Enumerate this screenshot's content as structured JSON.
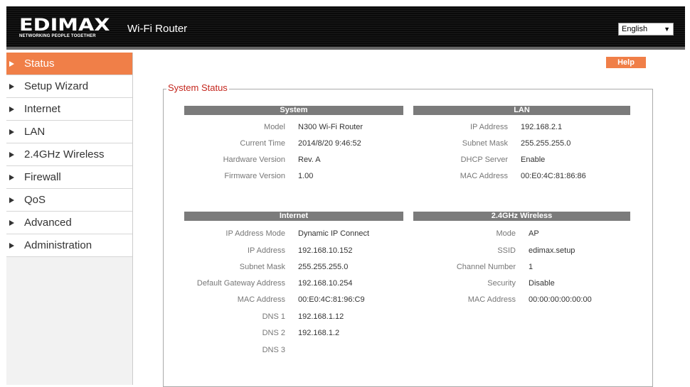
{
  "header": {
    "logo_text": "EDIMAX",
    "logo_tagline": "NETWORKING PEOPLE TOGETHER",
    "product_name": "Wi-Fi Router",
    "language": "English"
  },
  "sidebar": {
    "items": [
      {
        "label": "Status",
        "active": true
      },
      {
        "label": "Setup Wizard"
      },
      {
        "label": "Internet"
      },
      {
        "label": "LAN"
      },
      {
        "label": "2.4GHz Wireless"
      },
      {
        "label": "Firewall"
      },
      {
        "label": "QoS"
      },
      {
        "label": "Advanced"
      },
      {
        "label": "Administration"
      }
    ]
  },
  "help_label": "Help",
  "status": {
    "title": "System Status",
    "system": {
      "header": "System",
      "rows": [
        {
          "label": "Model",
          "value": "N300 Wi-Fi Router"
        },
        {
          "label": "Current Time",
          "value": "2014/8/20 9:46:52"
        },
        {
          "label": "Hardware Version",
          "value": "Rev. A"
        },
        {
          "label": "Firmware Version",
          "value": "1.00"
        }
      ]
    },
    "lan": {
      "header": "LAN",
      "rows": [
        {
          "label": "IP Address",
          "value": "192.168.2.1"
        },
        {
          "label": "Subnet Mask",
          "value": "255.255.255.0"
        },
        {
          "label": "DHCP Server",
          "value": "Enable"
        },
        {
          "label": "MAC Address",
          "value": "00:E0:4C:81:86:86"
        }
      ]
    },
    "internet": {
      "header": "Internet",
      "rows": [
        {
          "label": "IP Address Mode",
          "value": "Dynamic IP  Connect"
        },
        {
          "label": "IP Address",
          "value": "192.168.10.152"
        },
        {
          "label": "Subnet Mask",
          "value": "255.255.255.0"
        },
        {
          "label": "Default Gateway Address",
          "value": "192.168.10.254"
        },
        {
          "label": "MAC Address",
          "value": "00:E0:4C:81:96:C9"
        },
        {
          "label": "DNS 1",
          "value": "192.168.1.12"
        },
        {
          "label": "DNS 2",
          "value": "192.168.1.2"
        },
        {
          "label": "DNS 3",
          "value": ""
        }
      ]
    },
    "wireless": {
      "header": "2.4GHz  Wireless",
      "rows": [
        {
          "label": "Mode",
          "value": "AP"
        },
        {
          "label": "SSID",
          "value": "edimax.setup"
        },
        {
          "label": "Channel Number",
          "value": "1"
        },
        {
          "label": "Security",
          "value": "Disable"
        },
        {
          "label": "MAC Address",
          "value": "00:00:00:00:00:00"
        }
      ]
    }
  }
}
